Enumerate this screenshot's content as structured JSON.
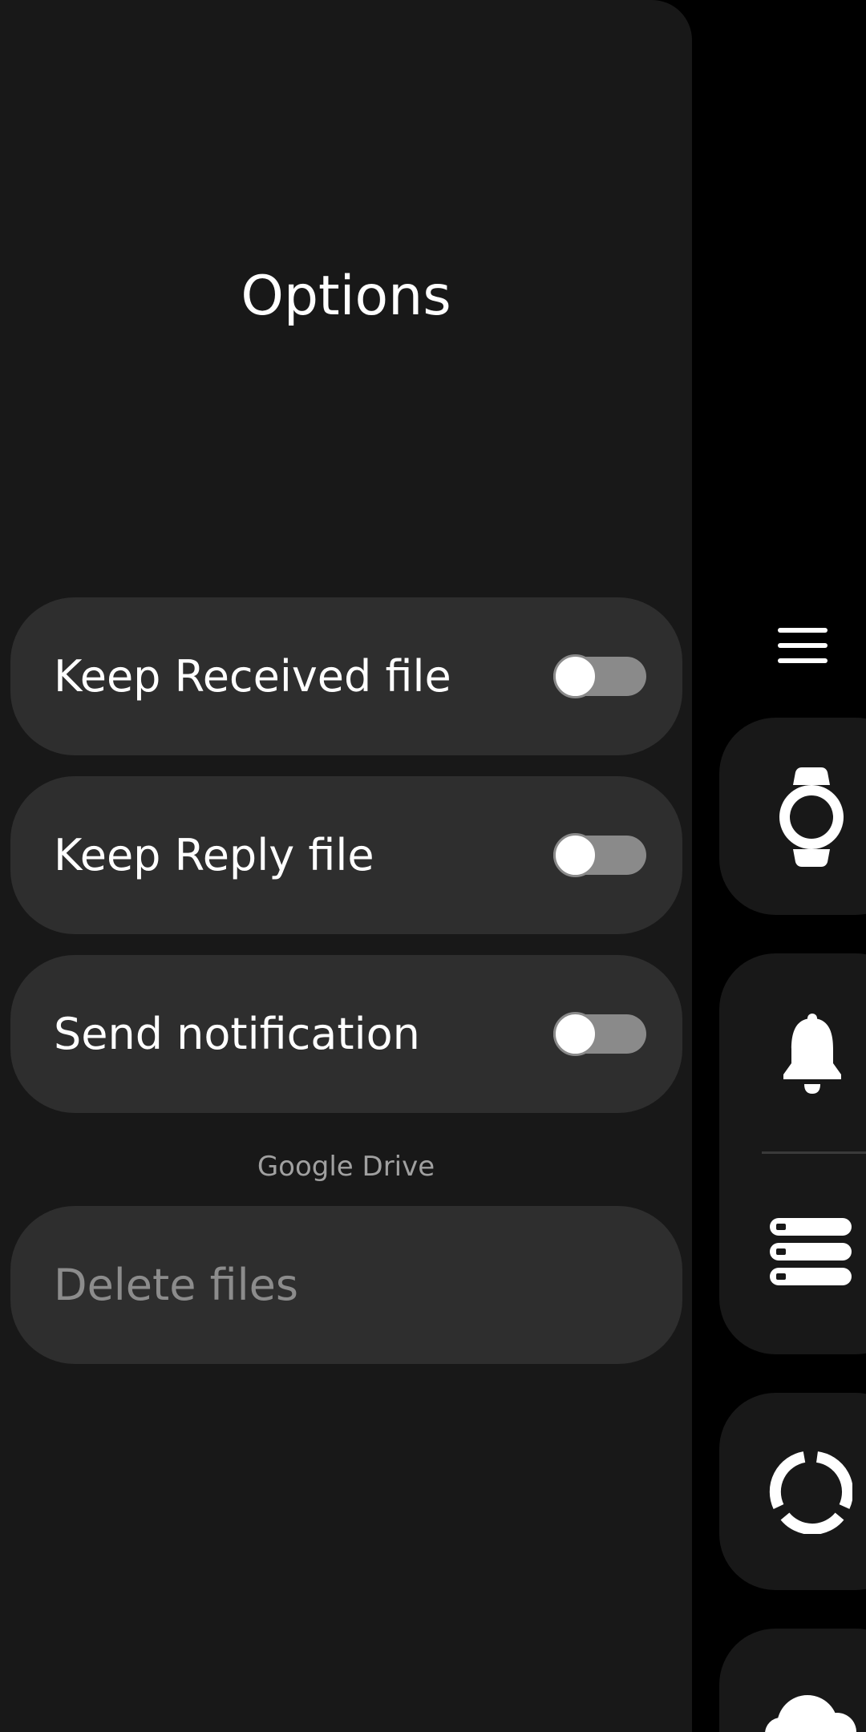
{
  "header": {
    "title": "Options"
  },
  "options": [
    {
      "label": "Keep Received file",
      "enabled": false
    },
    {
      "label": "Keep Reply file",
      "enabled": false
    },
    {
      "label": "Send notification",
      "enabled": false
    }
  ],
  "google_drive": {
    "section_label": "Google Drive",
    "delete_label": "Delete files"
  },
  "rail": {
    "icons": [
      "menu-icon",
      "watch-icon",
      "bell-icon",
      "storage-icon",
      "circle-progress-icon",
      "cloud-icon"
    ]
  },
  "colors": {
    "background": "#000000",
    "panel": "#181818",
    "card": "#2e2e2e",
    "toggle_off_track": "#8a8a8a",
    "text_primary": "#ffffff",
    "text_secondary": "#a0a0a0"
  }
}
